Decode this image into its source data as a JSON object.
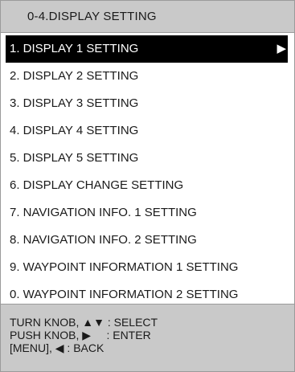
{
  "header": {
    "title": "0-4.DISPLAY SETTING"
  },
  "menu": {
    "selected_index": 0,
    "items": [
      {
        "label": "1. DISPLAY 1 SETTING",
        "arrow": "▶"
      },
      {
        "label": "2. DISPLAY 2 SETTING"
      },
      {
        "label": "3. DISPLAY 3 SETTING"
      },
      {
        "label": "4. DISPLAY 4 SETTING"
      },
      {
        "label": "5. DISPLAY 5 SETTING"
      },
      {
        "label": "6. DISPLAY CHANGE SETTING"
      },
      {
        "label": "7. NAVIGATION INFO. 1 SETTING"
      },
      {
        "label": "8. NAVIGATION INFO. 2 SETTING"
      },
      {
        "label": "9. WAYPOINT INFORMATION 1 SETTING"
      },
      {
        "label": "0. WAYPOINT INFORMATION 2 SETTING"
      }
    ]
  },
  "help": {
    "line1": "TURN KNOB, ▲▼ : SELECT",
    "line2": "PUSH KNOB, ▶     : ENTER",
    "line3": "[MENU], ◀ : BACK"
  },
  "colors": {
    "title_bar_bg": "#c9c9c9",
    "help_bar_bg": "#c9c9c9",
    "selected_bg": "#000000",
    "selected_fg": "#ffffff",
    "text": "#1a1a1a"
  }
}
